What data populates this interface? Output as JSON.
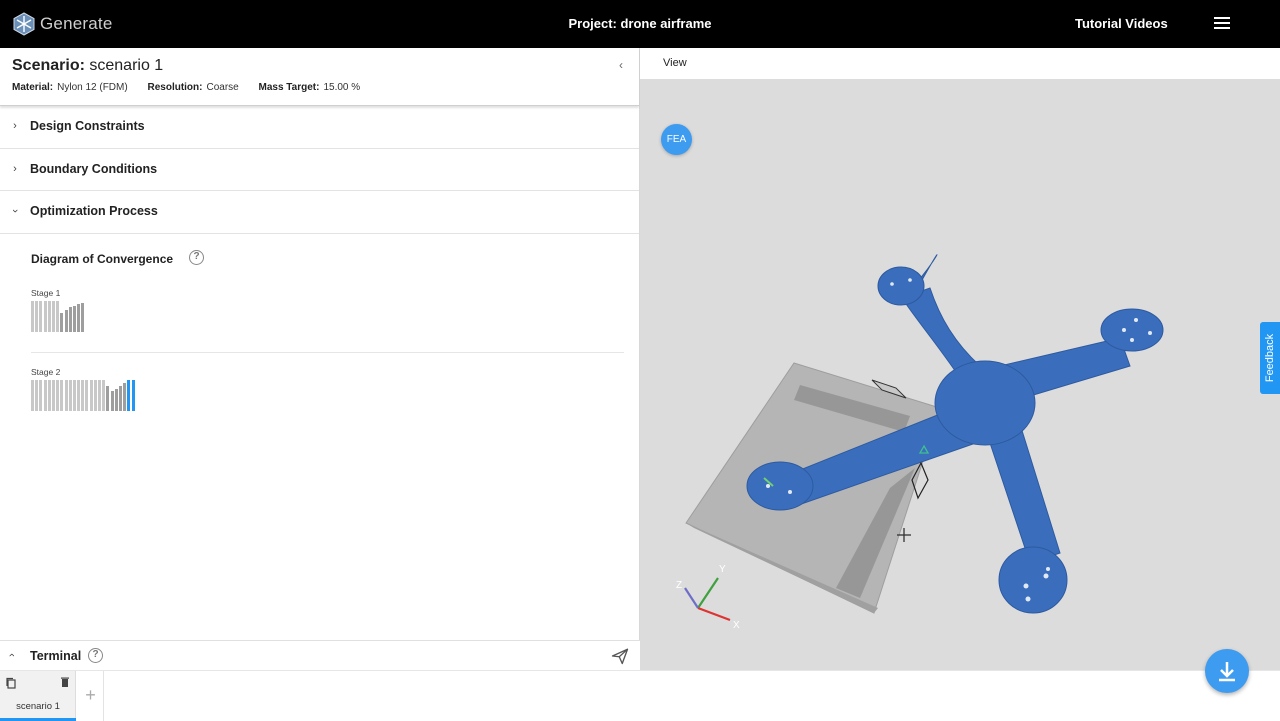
{
  "app": {
    "name": "Generate"
  },
  "header": {
    "project_title": "Project: drone airframe",
    "tutorial_label": "Tutorial Videos"
  },
  "scenario": {
    "title_prefix": "Scenario:",
    "title_name": "scenario 1",
    "material_label": "Material:",
    "material_value": "Nylon 12 (FDM)",
    "resolution_label": "Resolution:",
    "resolution_value": "Coarse",
    "mass_label": "Mass Target:",
    "mass_value": "15.00 %"
  },
  "sections": [
    {
      "label": "Design Constraints",
      "expanded": false
    },
    {
      "label": "Boundary Conditions",
      "expanded": false
    },
    {
      "label": "Optimization Process",
      "expanded": true
    }
  ],
  "convergence": {
    "title": "Diagram of Convergence",
    "stages": [
      {
        "label": "Stage 1",
        "bars": [
          1,
          1,
          1,
          1,
          1,
          1,
          1,
          0.6,
          0.7,
          0.8,
          0.85,
          0.9,
          0.95
        ]
      },
      {
        "label": "Stage 2",
        "bars": [
          1,
          1,
          1,
          1,
          1,
          1,
          1,
          1,
          1,
          1,
          1,
          1,
          1,
          1,
          1,
          1,
          1,
          1,
          0.8,
          0.65,
          0.7,
          0.8,
          0.9,
          1,
          1
        ]
      }
    ]
  },
  "terminal": {
    "label": "Terminal"
  },
  "tabs": [
    {
      "label": "scenario 1",
      "active": true
    }
  ],
  "add_tab_label": "+",
  "viewport": {
    "view_menu": "View",
    "fea_label": "FEA",
    "feedback_label": "Feedback",
    "axes": {
      "x": "X",
      "y": "Y",
      "z": "Z"
    }
  },
  "colors": {
    "accent": "#2196f3",
    "part": "#3a6ebd",
    "background_viewport": "#dcdcdc"
  },
  "icons": [
    "generate-logo-icon",
    "menu-icon",
    "chevron-left-icon",
    "chevron-right-icon",
    "chevron-down-icon",
    "help-icon",
    "send-icon",
    "copy-icon",
    "trash-icon",
    "plus-icon",
    "download-icon"
  ]
}
